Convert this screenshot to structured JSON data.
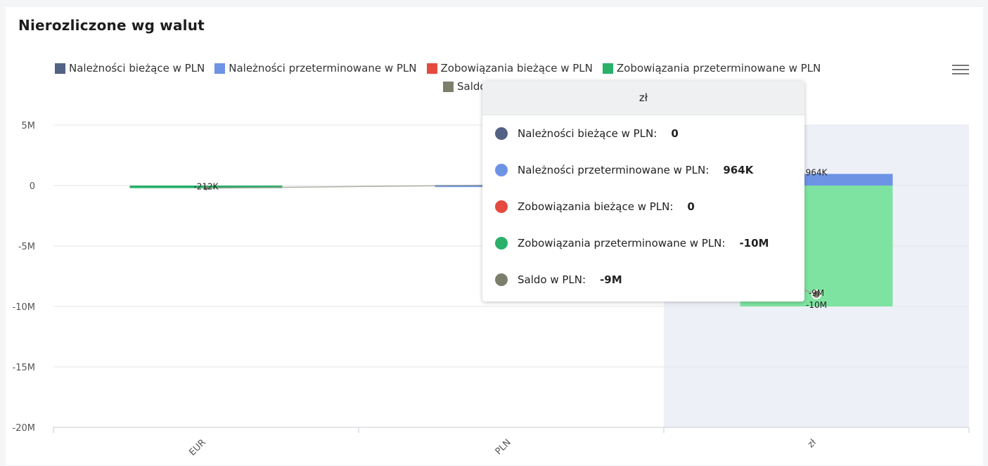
{
  "chart_data": {
    "type": "bar",
    "title": "Nierozliczone wg walut",
    "categories": [
      "EUR",
      "PLN",
      "zł"
    ],
    "y_tick_labels": [
      "5M",
      "0",
      "-5M",
      "-10M",
      "-15M",
      "-20M"
    ],
    "ylim": [
      -20000000,
      5000000
    ],
    "stacked": true,
    "grid": true,
    "legend_position": "top",
    "series": [
      {
        "name": "Należności bieżące w PLN",
        "color": "#536184",
        "kind": "bar",
        "values": [
          0,
          0,
          0
        ]
      },
      {
        "name": "Należności przeterminowane w PLN",
        "color": "#6d93e5",
        "kind": "bar",
        "values": [
          0,
          50000,
          964000
        ]
      },
      {
        "name": "Zobowiązania bieżące w PLN",
        "color": "#e44a3f",
        "kind": "bar",
        "values": [
          0,
          0,
          0
        ]
      },
      {
        "name": "Zobowiązania przeterminowane w PLN",
        "color": "#2bb06a",
        "kind": "bar",
        "values": [
          -212000,
          0,
          -10000000
        ]
      },
      {
        "name": "Saldo w PLN",
        "color": "#7c7f6c",
        "kind": "line",
        "values": [
          -212000,
          50000,
          -9000000
        ]
      }
    ],
    "data_labels": [
      {
        "category": "EUR",
        "value": -212000,
        "text": "-212K"
      },
      {
        "category": "zł",
        "value": 964000,
        "text": "964K"
      },
      {
        "category": "zł",
        "value": -10000000,
        "text": "-10M"
      },
      {
        "category": "zł",
        "value": -9000000,
        "text": "-9M"
      }
    ],
    "highlighted_category": "zł"
  },
  "legend_labels": {
    "s1": "Należności bieżące w PLN",
    "s2": "Należności przeterminowane w PLN",
    "s3": "Zobowiązania bieżące w PLN",
    "s4": "Zobowiązania przeterminowane w PLN",
    "s5": "Saldo w PLN"
  },
  "colors": {
    "s1": "#536184",
    "s2": "#6d93e5",
    "s3": "#e44a3f",
    "s4": "#2bb06a",
    "s5": "#7c7f6c",
    "highlight_band": "#eef0f8"
  },
  "menu_icon": "hamburger-menu-icon",
  "tooltip": {
    "header": "zł",
    "rows": [
      {
        "label": "Należności bieżące w PLN:",
        "value": "0",
        "color": "#536184"
      },
      {
        "label": "Należności przeterminowane w PLN:",
        "value": "964K",
        "color": "#6d93e5"
      },
      {
        "label": "Zobowiązania bieżące w PLN:",
        "value": "0",
        "color": "#e44a3f"
      },
      {
        "label": "Zobowiązania przeterminowane w PLN:",
        "value": "-10M",
        "color": "#2bb06a"
      },
      {
        "label": "Saldo w PLN:",
        "value": "-9M",
        "color": "#7c7f6c"
      }
    ]
  }
}
